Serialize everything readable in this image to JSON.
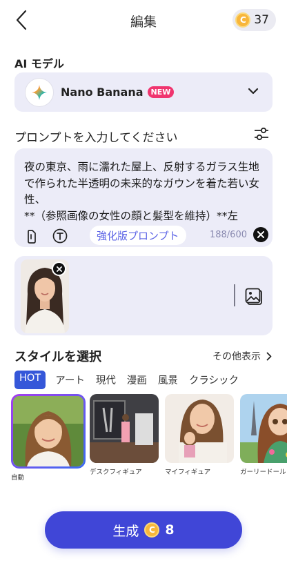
{
  "header": {
    "title": "編集",
    "coin_balance": "37",
    "coin_symbol": "C"
  },
  "model": {
    "label": "AI モデル",
    "name": "Nano Banana",
    "badge": "NEW"
  },
  "prompt": {
    "label": "プロンプトを入力してください",
    "text": "夜の東京、雨に濡れた屋上、反射するガラス生地で作られた半透明の未来的なガウンを着た若い女性、\n**（参照画像の女性の顔と髪型を維持）**左",
    "enhance_label": "強化版プロンプト",
    "char_count": "188/600"
  },
  "styles": {
    "title": "スタイルを選択",
    "more_label": "その他表示",
    "tabs": [
      "HOT",
      "アート",
      "現代",
      "漫画",
      "風景",
      "クラシック"
    ],
    "active_tab": "HOT",
    "cards": [
      {
        "label": "自動",
        "selected": true
      },
      {
        "label": "デスクフィギュア",
        "selected": false
      },
      {
        "label": "マイフィギュア",
        "selected": false
      },
      {
        "label": "ガーリードール",
        "selected": false
      }
    ]
  },
  "generate": {
    "label": "生成",
    "coin_symbol": "C",
    "cost": "8"
  },
  "colors": {
    "accent": "#4046d7",
    "panel": "#ececf8",
    "new_badge": "#f0356f",
    "coin": "#f8b63b",
    "active_tab": "#3557d9"
  }
}
